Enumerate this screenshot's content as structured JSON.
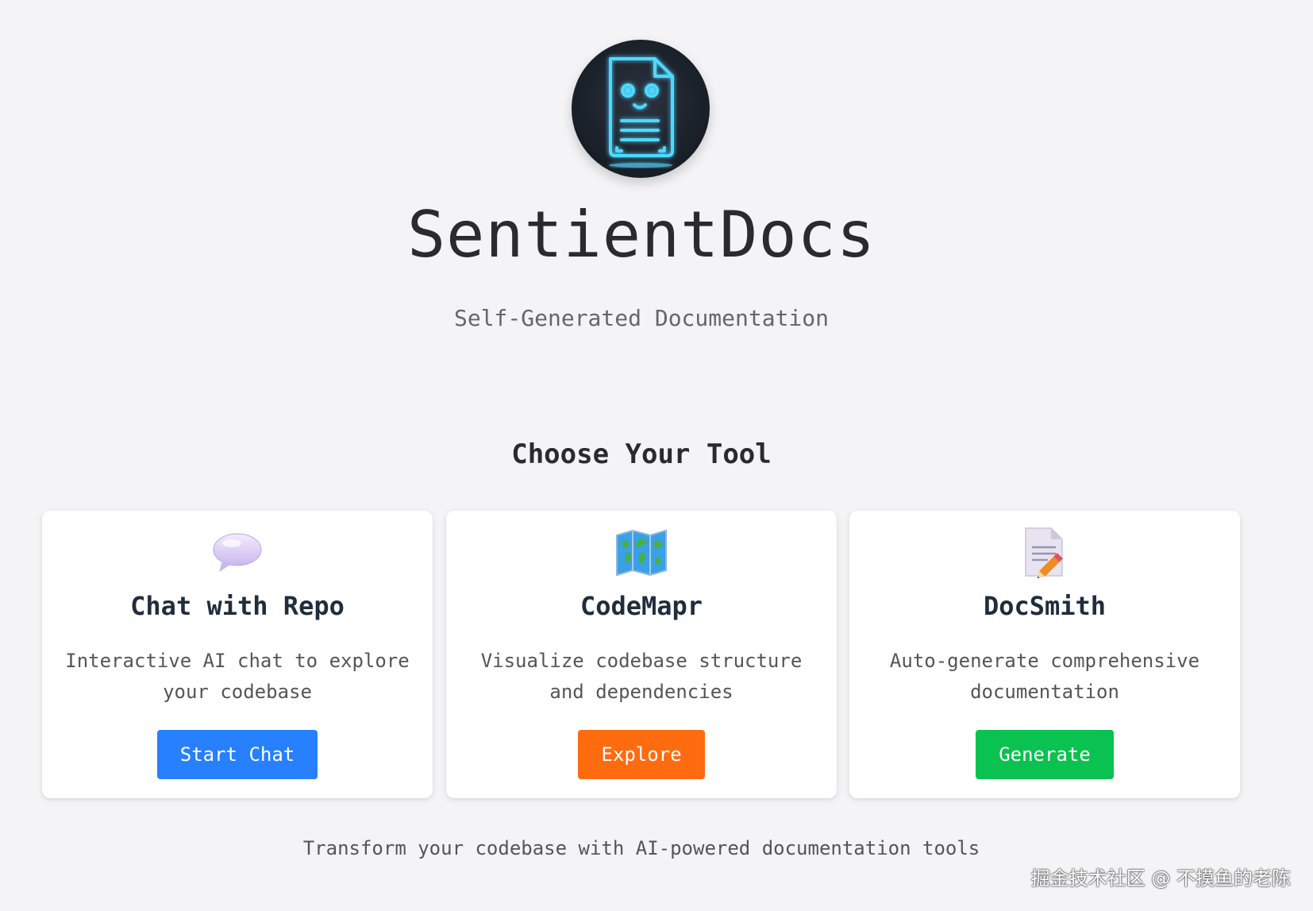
{
  "header": {
    "logo_icon": "glowing-document-robot-icon",
    "title": "SentientDocs",
    "subtitle": "Self-Generated Documentation"
  },
  "tools": {
    "heading": "Choose Your Tool",
    "cards": [
      {
        "icon": "speech-bubble-icon",
        "title": "Chat with Repo",
        "description": "Interactive AI chat to explore your codebase",
        "button_label": "Start Chat",
        "button_color": "#2680ff"
      },
      {
        "icon": "world-map-icon",
        "title": "CodeMapr",
        "description": "Visualize codebase structure and dependencies",
        "button_label": "Explore",
        "button_color": "#ff6b0f"
      },
      {
        "icon": "document-pencil-icon",
        "title": "DocSmith",
        "description": "Auto-generate comprehensive documentation",
        "button_label": "Generate",
        "button_color": "#09c250"
      }
    ]
  },
  "footer": {
    "tagline": "Transform your codebase with AI-powered documentation tools"
  },
  "watermark": "掘金技术社区 @ 不摸鱼的老陈"
}
